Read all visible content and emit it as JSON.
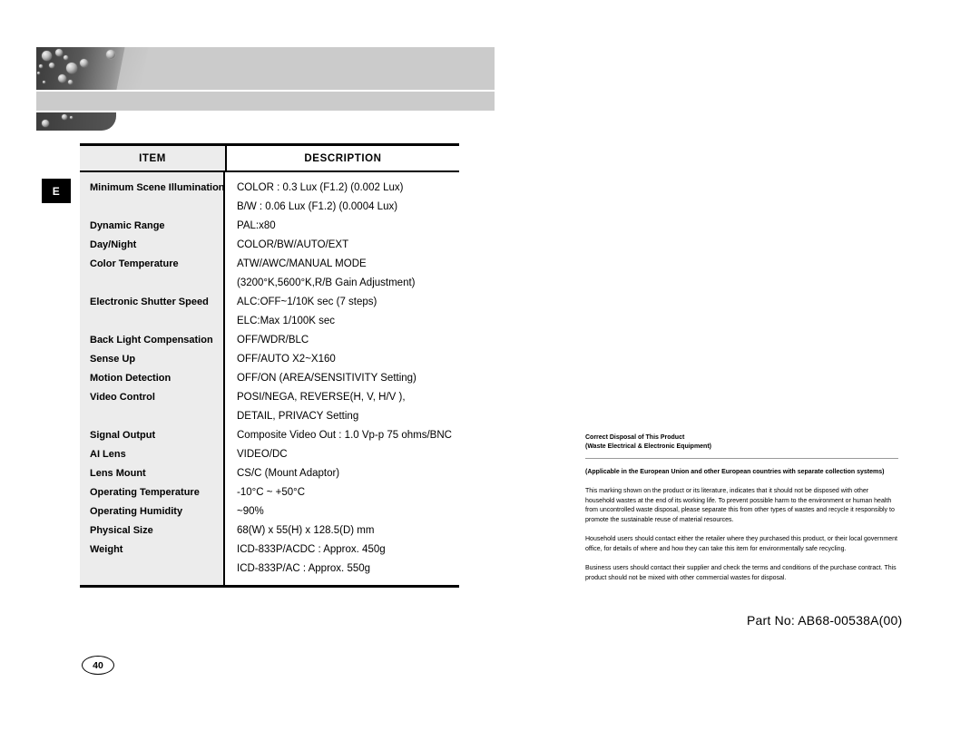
{
  "header": {
    "edition_marker": "E"
  },
  "table": {
    "columns": [
      "ITEM",
      "DESCRIPTION"
    ],
    "items": [
      "Minimum Scene Illumination",
      "",
      "Dynamic Range",
      "Day/Night",
      "Color Temperature",
      "",
      "Electronic Shutter Speed",
      "",
      "Back Light Compensation",
      "Sense Up",
      "Motion Detection",
      "Video Control",
      "",
      "Signal Output",
      "AI Lens",
      "Lens Mount",
      "Operating Temperature",
      "Operating  Humidity",
      "Physical Size",
      "Weight",
      ""
    ],
    "descriptions": [
      "COLOR : 0.3 Lux (F1.2) (0.002 Lux)",
      "B/W : 0.06 Lux (F1.2) (0.0004 Lux)",
      "PAL:x80",
      "COLOR/BW/AUTO/EXT",
      "ATW/AWC/MANUAL MODE",
      "(3200°K,5600°K,R/B Gain Adjustment)",
      "ALC:OFF~1/10K sec (7 steps)",
      "ELC:Max 1/100K sec",
      "OFF/WDR/BLC",
      "OFF/AUTO X2~X160",
      "OFF/ON (AREA/SENSITIVITY Setting)",
      "POSI/NEGA, REVERSE(H, V, H/V ),",
      "DETAIL, PRIVACY Setting",
      "Composite Video Out : 1.0 Vp-p 75 ohms/BNC",
      "VIDEO/DC",
      "CS/C (Mount Adaptor)",
      "-10°C ~ +50°C",
      "~90%",
      "68(W) x 55(H) x 128.5(D) mm",
      "ICD-833P/ACDC : Approx. 450g",
      "ICD-833P/AC : Approx. 550g"
    ]
  },
  "disposal_notice": {
    "title_line1": "Correct Disposal of This Product",
    "title_line2": " (Waste Electrical & Electronic Equipment)",
    "applicable": "(Applicable in the European Union and other European countries with separate collection systems)",
    "paragraph_1": "This marking shown on the product or its literature, indicates that it should not be disposed with other household wastes at the end of its working life.  To prevent possible harm to the environment or human health from uncontrolled waste disposal, please separate this from other types of wastes and recycle it responsibly to promote the sustainable reuse of material resources.",
    "paragraph_2": "Household users should contact either the retailer where they purchased this product, or their local government office, for details of where and how they can take this item for environmentally safe recycling.",
    "paragraph_3": "Business users should contact their supplier and check the terms and conditions of the purchase contract. This product should not be mixed with other commercial wastes for disposal."
  },
  "footer": {
    "part_number": "Part No: AB68-00538A(00)",
    "page_number": "40"
  }
}
